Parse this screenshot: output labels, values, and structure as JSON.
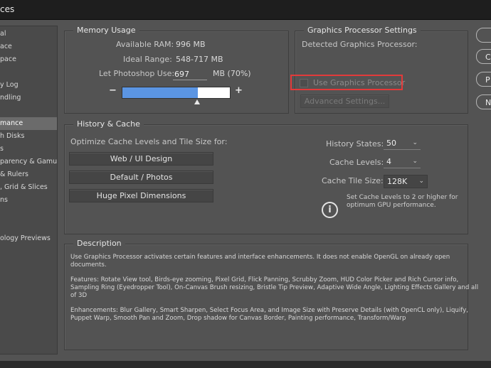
{
  "window": {
    "title_fragment": "ces"
  },
  "sidebar": {
    "items": [
      {
        "label": "al",
        "active": false
      },
      {
        "label": "ace",
        "active": false
      },
      {
        "label": "pace",
        "active": false
      },
      {
        "label": "",
        "active": false
      },
      {
        "label": "y Log",
        "active": false
      },
      {
        "label": "ndling",
        "active": false
      },
      {
        "label": "",
        "active": false
      },
      {
        "label": "mance",
        "active": false
      },
      {
        "label": "h Disks",
        "active": false
      },
      {
        "label": "s",
        "active": false
      },
      {
        "label": "parency & Gamut",
        "active": false
      },
      {
        "label": "& Rulers",
        "active": false
      },
      {
        "label": ", Grid & Slices",
        "active": false
      },
      {
        "label": "ns",
        "active": false
      },
      {
        "label": "",
        "active": false
      },
      {
        "label": "ology Previews",
        "active": false
      }
    ],
    "active_index": 7
  },
  "memory": {
    "legend": "Memory Usage",
    "available_label": "Available RAM:",
    "available_value": "996 MB",
    "ideal_label": "Ideal Range:",
    "ideal_value": "548-717 MB",
    "let_label": "Let Photoshop Use:",
    "let_value": "697",
    "let_suffix": "MB (70%)",
    "minus": "−",
    "plus": "+",
    "slider_fraction": 0.7
  },
  "gpu": {
    "legend": "Graphics Processor Settings",
    "detected_label": "Detected Graphics Processor:",
    "use_label": "Use Graphics Processor",
    "use_checked": false,
    "advanced_label": "Advanced Settings..."
  },
  "history": {
    "legend": "History & Cache",
    "optimize_label": "Optimize Cache Levels and Tile Size for:",
    "buttons": [
      "Web / UI Design",
      "Default / Photos",
      "Huge Pixel Dimensions"
    ],
    "states_label": "History States:",
    "states_value": "50",
    "levels_label": "Cache Levels:",
    "levels_value": "4",
    "tile_label": "Cache Tile Size:",
    "tile_value": "128K",
    "note_line1": "Set Cache Levels to 2 or higher for",
    "note_line2": "optimum GPU performance.",
    "info_icon": "info-circle"
  },
  "description": {
    "legend": "Description",
    "p1_l1": "Use Graphics Processor activates certain features and interface enhancements. It does not enable OpenGL on already open",
    "p1_l2": "documents.",
    "p2_l1": "Features: Rotate View tool, Birds-eye zooming, Pixel Grid, Flick Panning, Scrubby Zoom, HUD Color Picker and Rich Cursor info,",
    "p2_l2": "Sampling Ring (Eyedropper Tool), On-Canvas Brush resizing, Bristle Tip Preview, Adaptive Wide Angle, Lighting Effects Gallery and all",
    "p2_l3": "of 3D",
    "p3_l1": "Enhancements: Blur Gallery, Smart Sharpen, Select Focus Area, and Image Size with Preserve Details (with OpenCL only), Liquify,",
    "p3_l2": "Puppet Warp, Smooth Pan and Zoom, Drop shadow for Canvas Border, Painting performance, Transform/Warp"
  },
  "right_buttons": [
    "",
    "C",
    "P",
    "N"
  ]
}
